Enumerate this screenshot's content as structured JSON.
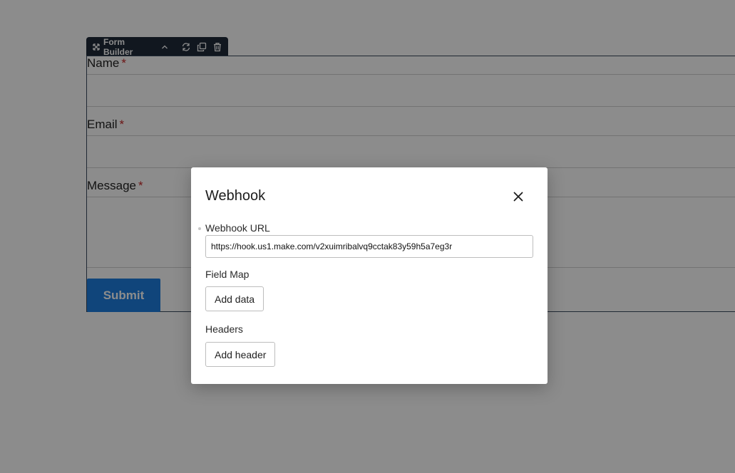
{
  "toolbar": {
    "label": "Form Builder",
    "move_icon": "move-arrows-icon",
    "collapse_icon": "chevron-up-icon",
    "refresh_icon": "refresh-icon",
    "duplicate_icon": "duplicate-icon",
    "delete_icon": "trash-icon"
  },
  "form": {
    "fields": [
      {
        "label": "Name",
        "required_mark": "*"
      },
      {
        "label": "Email",
        "required_mark": "*"
      },
      {
        "label": "Message",
        "required_mark": "*"
      }
    ],
    "submit_label": "Submit"
  },
  "modal": {
    "title": "Webhook",
    "close_icon": "close-icon",
    "webhook_url_label": "Webhook URL",
    "webhook_url_value": "https://hook.us1.make.com/v2xuimribalvq9cctak83y59h5a7eg3r",
    "field_map_label": "Field Map",
    "add_data_label": "Add data",
    "headers_label": "Headers",
    "add_header_label": "Add header"
  },
  "colors": {
    "toolbar_bg": "#1f2a3a",
    "submit_bg": "#1e7fe0",
    "required": "#c62828"
  }
}
